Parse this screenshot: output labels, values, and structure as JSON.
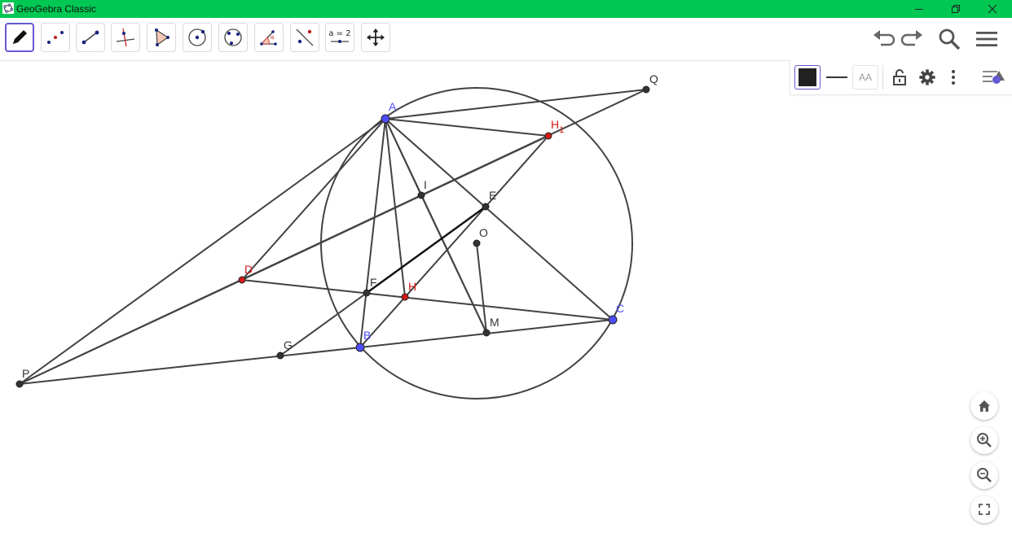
{
  "window": {
    "title": "GeoGebra Classic"
  },
  "toolbar": {
    "tools": [
      {
        "id": "pen-tool-button",
        "icon": "pen-icon",
        "active": true
      },
      {
        "id": "point-tool-button",
        "icon": "point-icon"
      },
      {
        "id": "segment-tool-button",
        "icon": "segment-icon"
      },
      {
        "id": "perpendicular-tool-button",
        "icon": "perpendicular-line-icon"
      },
      {
        "id": "polygon-tool-button",
        "icon": "polygon-icon"
      },
      {
        "id": "circle-tool-button",
        "icon": "circle-center-point-icon"
      },
      {
        "id": "circle-three-points-tool-button",
        "icon": "circle-three-points-icon"
      },
      {
        "id": "angle-tool-button",
        "icon": "angle-icon"
      },
      {
        "id": "reflect-tool-button",
        "icon": "reflect-icon"
      },
      {
        "id": "slider-tool-button",
        "icon": "slider-icon"
      },
      {
        "id": "move-view-tool-button",
        "icon": "move-view-icon"
      }
    ],
    "slider_label": "a = 2"
  },
  "stylebar": {
    "line_color": "#212121",
    "text_size_label": "AA"
  },
  "colors": {
    "titlebar": "#00c853",
    "accent": "#6557d2",
    "free_point": "#4d4dff",
    "dependent_point": "#d31a1a",
    "construction_point": "#333333",
    "line": "#424242"
  },
  "points": {
    "A": {
      "label": "A"
    },
    "B": {
      "label": "B"
    },
    "C": {
      "label": "C"
    },
    "D": {
      "label": "D"
    },
    "E": {
      "label": "E"
    },
    "F": {
      "label": "F"
    },
    "G": {
      "label": "G"
    },
    "H": {
      "label": "H"
    },
    "I": {
      "label": "I"
    },
    "M": {
      "label": "M"
    },
    "O": {
      "label": "O"
    },
    "P": {
      "label": "P"
    },
    "Q": {
      "label": "Q"
    },
    "H1": {
      "label": "H",
      "subscript": "1"
    }
  }
}
